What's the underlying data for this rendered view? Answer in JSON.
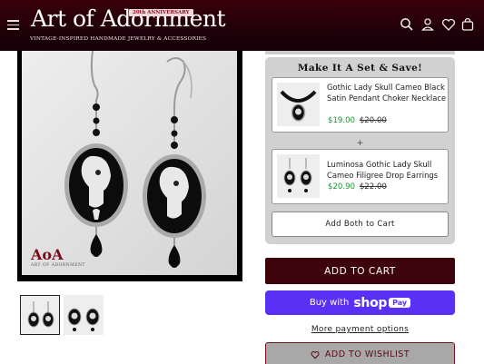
{
  "header": {
    "brand": "Art of Adornment",
    "anniversary_badge": "20th ANNIVERSARY",
    "tagline": "VINTAGE-INSPIRED HANDMADE JEWELRY & ACCESSORIES",
    "icons": [
      "menu-icon",
      "search-icon",
      "account-icon",
      "wishlist-heart-icon",
      "cart-icon"
    ]
  },
  "gallery": {
    "watermark": "AoA",
    "watermark_sub": "ART OF ADORNMENT",
    "thumbnails": 2,
    "active_thumbnail": 1
  },
  "bundle": {
    "title": "Make It A Set & Save!",
    "items": [
      {
        "name": "Gothic Lady Skull Cameo Black Satin Pendant Choker Necklace",
        "price": "$19.00",
        "compare_price": "$20.00"
      },
      {
        "name": "Luminosa Gothic Lady Skull Cameo Filigree Drop Earrings",
        "price": "$20.90",
        "compare_price": "$22.00"
      }
    ],
    "separator": "+",
    "add_both_label": "Add Both to Cart"
  },
  "actions": {
    "add_to_cart": "ADD TO CART",
    "shop_pay_prefix": "Buy with",
    "shop_pay_brand": "shop",
    "shop_pay_badge": "Pay",
    "more_payment": "More payment options",
    "wishlist": "ADD TO WISHLIST"
  },
  "colors": {
    "header_bg": "#22000a",
    "accent": "#3e040c",
    "sale_price": "#129b2e",
    "shop_pay": "#5a31f4"
  }
}
